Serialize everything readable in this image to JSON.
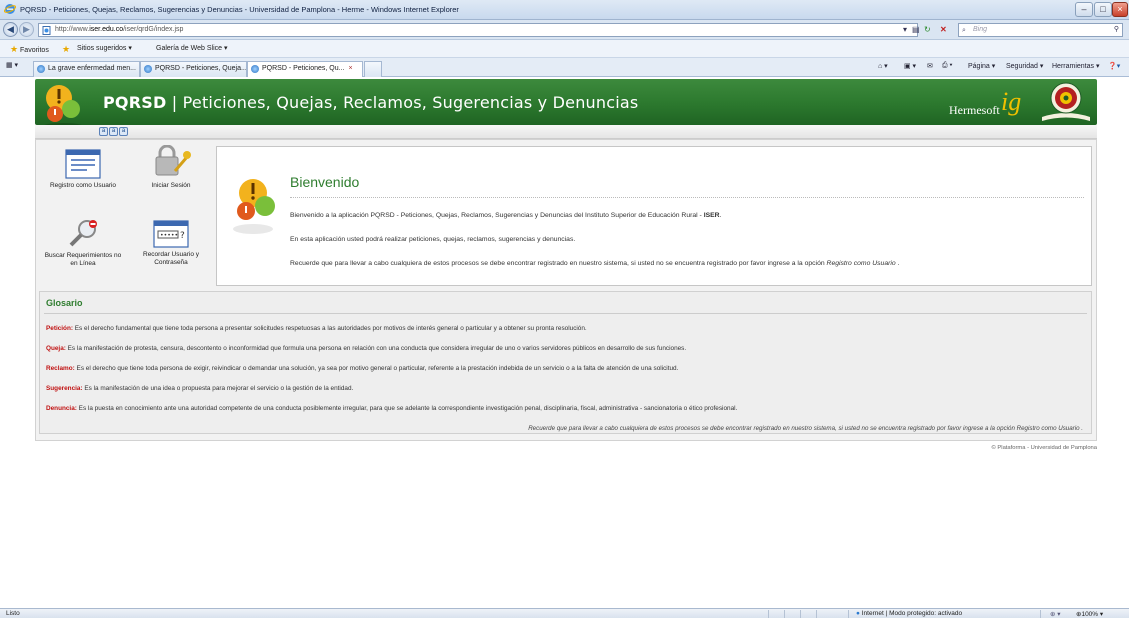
{
  "window": {
    "title": "PQRSD - Peticiones, Quejas, Reclamos, Sugerencias y Denuncias - Universidad de Pamplona - Herme - Windows Internet Explorer",
    "url_prefix": "http://www.",
    "url_domain": "iser.edu.co",
    "url_path": "/iser/qrdG/index.jsp",
    "search_placeholder": "Bing"
  },
  "favorites": {
    "label": "Favoritos",
    "items": [
      "Sitios sugeridos ▾",
      "Galería de Web Slice ▾"
    ]
  },
  "tabs": [
    {
      "label": "La grave enfermedad men..."
    },
    {
      "label": "PQRSD - Peticiones, Queja..."
    },
    {
      "label": "PQRSD - Peticiones, Qu...",
      "close": "×"
    }
  ],
  "commandbar": {
    "page": "Página ▾",
    "safety": "Seguridad ▾",
    "tools": "Herramientas ▾"
  },
  "banner": {
    "title_bold": "PQRSD",
    "title_rest": "| Peticiones, Quejas, Reclamos, Sugerencias y Denuncias",
    "brand": "Hermesoft",
    "brand_mark": "ig"
  },
  "font_buttons": [
    "a",
    "a",
    "a"
  ],
  "quick_links": {
    "registro": "Registro como Usuario",
    "iniciar": "Iniciar Sesión",
    "buscar_1": "Buscar Requerimientos no",
    "buscar_2": "en Línea",
    "recordar_1": "Recordar Usuario y",
    "recordar_2": "Contraseña"
  },
  "welcome": {
    "title": "Bienvenido",
    "line1_a": "Bienvenido a la aplicación PQRSD - Peticiones, Quejas, Reclamos, Sugerencias y Denuncias del Instituto Superior de Educación Rural - ",
    "line1_b": "ISER",
    "line1_c": ".",
    "line2": "En esta aplicación usted podrá realizar peticiones, quejas, reclamos, sugerencias y denuncias.",
    "line3_a": "Recuerde que para llevar a cabo cualquiera de estos procesos se debe encontrar registrado en nuestro sistema, si usted no se encuentra registrado por favor ingrese a la opción ",
    "line3_b": "Registro como Usuario",
    "line3_c": " ."
  },
  "glosario": {
    "title": "Glosario",
    "entries": [
      {
        "term": "Petición:",
        "text": " Es el derecho fundamental que tiene toda persona a presentar solicitudes respetuosas a las autoridades por motivos de interés general o particular y a obtener su pronta resolución."
      },
      {
        "term": "Queja:",
        "text": " Es la manifestación de protesta, censura, descontento o inconformidad que formula una persona en relación con una conducta que considera irregular de uno o varios servidores públicos en desarrollo de sus funciones."
      },
      {
        "term": "Reclamo:",
        "text": " Es el derecho que tiene toda persona de exigir, reivindicar o demandar una solución, ya sea por motivo general o particular, referente a la prestación indebida de un servicio o a la falta de atención de una solicitud."
      },
      {
        "term": "Sugerencia:",
        "text": " Es la manifestación de una idea o propuesta para mejorar el servicio o la gestión de la entidad."
      },
      {
        "term": "Denuncia:",
        "text": " Es la puesta en conocimiento ante una autoridad competente de una conducta posiblemente irregular, para que se adelante la correspondiente investigación penal, disciplinaria, fiscal, administrativa - sancionatoria o ético profesional."
      }
    ],
    "footer": "Recuerde que para llevar a cabo cualquiera de estos procesos se debe encontrar registrado en nuestro sistema, si usted no se encuentra registrado por favor ingrese a la opción Registro como Usuario ."
  },
  "credit": "© Plataforma - Universidad de Pamplona",
  "status": {
    "text": "Listo",
    "zone": "Internet | Modo protegido: activado",
    "zoom": "100%"
  },
  "colors": {
    "banner_green": "#2d7a2f",
    "heading_green": "#2f7d2f",
    "term_red": "#c01010"
  }
}
